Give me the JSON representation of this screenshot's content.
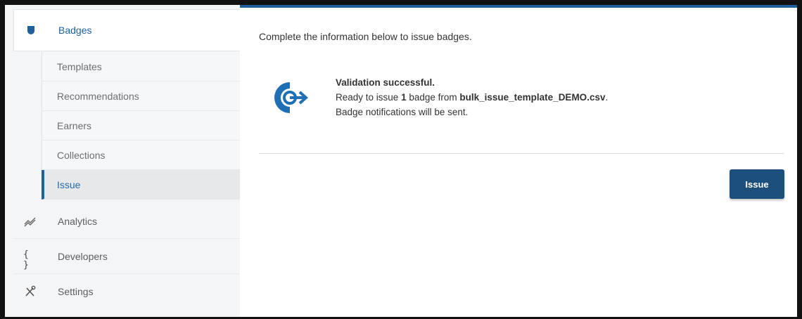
{
  "sidebar": {
    "primary": {
      "label": "Badges",
      "icon": "badge-shield-icon"
    },
    "subitems": [
      {
        "label": "Templates"
      },
      {
        "label": "Recommendations"
      },
      {
        "label": "Earners"
      },
      {
        "label": "Collections"
      },
      {
        "label": "Issue",
        "active": true
      }
    ],
    "items": [
      {
        "label": "Analytics",
        "icon": "analytics-icon"
      },
      {
        "label": "Developers",
        "icon": "code-braces-icon",
        "glyph": "{ }"
      },
      {
        "label": "Settings",
        "icon": "tools-icon"
      }
    ]
  },
  "main": {
    "intro": "Complete the information below to issue badges.",
    "status": {
      "title": "Validation successful.",
      "line1_prefix": "Ready to issue ",
      "count": "1",
      "line1_mid": " badge from ",
      "filename": "bulk_issue_template_DEMO.csv",
      "line1_suffix": ".",
      "line2": "Badge notifications will be sent."
    },
    "issue_label": "Issue"
  },
  "colors": {
    "accent": "#1f5f9a",
    "button": "#1d4f7c"
  }
}
